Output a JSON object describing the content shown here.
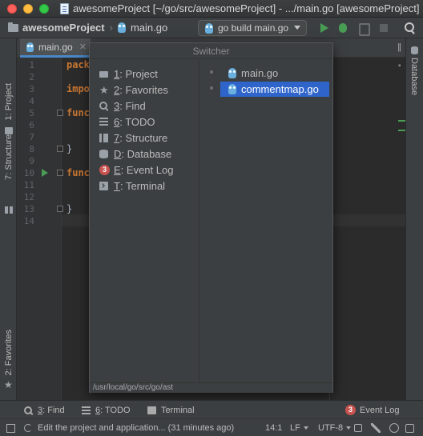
{
  "window": {
    "title": "awesomeProject [~/go/src/awesomeProject] - .../main.go [awesomeProject]"
  },
  "navbar": {
    "project": "awesomeProject",
    "file": "main.go",
    "run_config": "go build main.go"
  },
  "left_tools": {
    "project": "1: Project",
    "structure": "7: Structure",
    "favorites": "2: Favorites"
  },
  "right_tools": {
    "database": "Database"
  },
  "editor": {
    "tab": "main.go",
    "lines": [
      "1",
      "2",
      "3",
      "4",
      "5",
      "6",
      "7",
      "8",
      "9",
      "10",
      "11",
      "12",
      "13",
      "14"
    ],
    "code": {
      "l1": "pack",
      "l3": "impo",
      "l5": "func",
      "l8": "}",
      "l10": "func",
      "l13": "}"
    }
  },
  "switcher": {
    "title": "Switcher",
    "tool_windows": [
      {
        "key": "1",
        "rest": ": Project",
        "icon": "folder-icon"
      },
      {
        "key": "2",
        "rest": ": Favorites",
        "icon": "star-icon"
      },
      {
        "key": "3",
        "rest": ": Find",
        "icon": "search-icon"
      },
      {
        "key": "6",
        "rest": ": TODO",
        "icon": "list-icon"
      },
      {
        "key": "7",
        "rest": ": Structure",
        "icon": "structure-icon"
      },
      {
        "key": "D",
        "rest": ": Database",
        "icon": "database-icon"
      },
      {
        "key": "E",
        "rest": ": Event Log",
        "icon": "event-log-badge-icon",
        "badge": "3"
      },
      {
        "key": "T",
        "rest": ": Terminal",
        "icon": "terminal-icon"
      }
    ],
    "files": [
      "main.go",
      "commentmap.go"
    ],
    "selected_file": "commentmap.go",
    "path": "/usr/local/go/src/go/ast"
  },
  "bottom_bar": {
    "find_key": "3",
    "find_rest": ": Find",
    "todo_key": "6",
    "todo_rest": ": TODO",
    "terminal": "Terminal",
    "event_log_badge": "3",
    "event_log": "Event Log"
  },
  "status": {
    "message": "Edit the project and application... (31 minutes ago)",
    "position": "14:1",
    "line_sep": "LF",
    "encoding": "UTF-8"
  },
  "colors": {
    "accent": "#2f65ca",
    "badge": "#c75450",
    "run": "#499c54"
  }
}
